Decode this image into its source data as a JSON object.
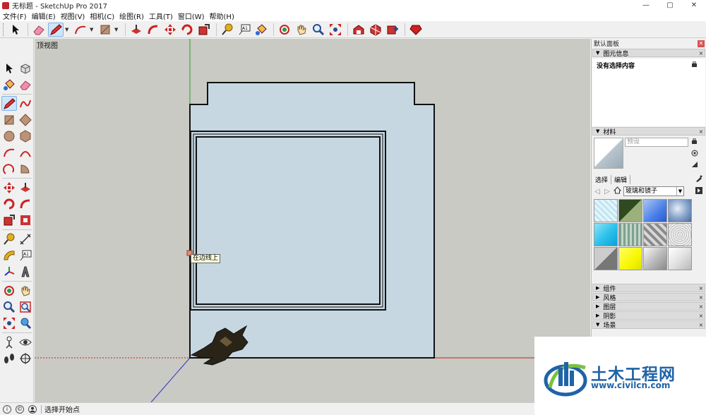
{
  "window": {
    "title": "无标题 - SketchUp Pro 2017",
    "minimize": "—",
    "maximize": "▢",
    "close": "✕"
  },
  "menu": [
    "文件(F)",
    "编辑(E)",
    "视图(V)",
    "相机(C)",
    "绘图(R)",
    "工具(T)",
    "窗口(W)",
    "帮助(H)"
  ],
  "viewport": {
    "view_name": "顶视图",
    "inference_tooltip": "在边线上"
  },
  "tray": {
    "title": "默认面板",
    "close": "✕",
    "entity_info": {
      "header": "图元信息",
      "content": "没有选择内容"
    },
    "materials": {
      "header": "材料",
      "name_placeholder": "预设",
      "tab_select": "选择",
      "tab_edit": "编辑",
      "library": "玻璃和镜子"
    },
    "collapsed": [
      "组件",
      "风格",
      "图层",
      "阴影",
      "场景"
    ],
    "collapsed_icon": "▶",
    "expanded_icon": "▼",
    "close_x": "×"
  },
  "status": {
    "text": "选择开始点"
  },
  "watermark": {
    "name": "土木工程网",
    "url": "www.civilcn.com"
  },
  "colors": {
    "viewport_bg": "#c8cac3",
    "model_fill": "#c6d7e1",
    "axis_red": "#d21f1f",
    "axis_green": "#2aa02a",
    "axis_blue": "#3030c8",
    "brand_blue": "#1f63a8"
  }
}
